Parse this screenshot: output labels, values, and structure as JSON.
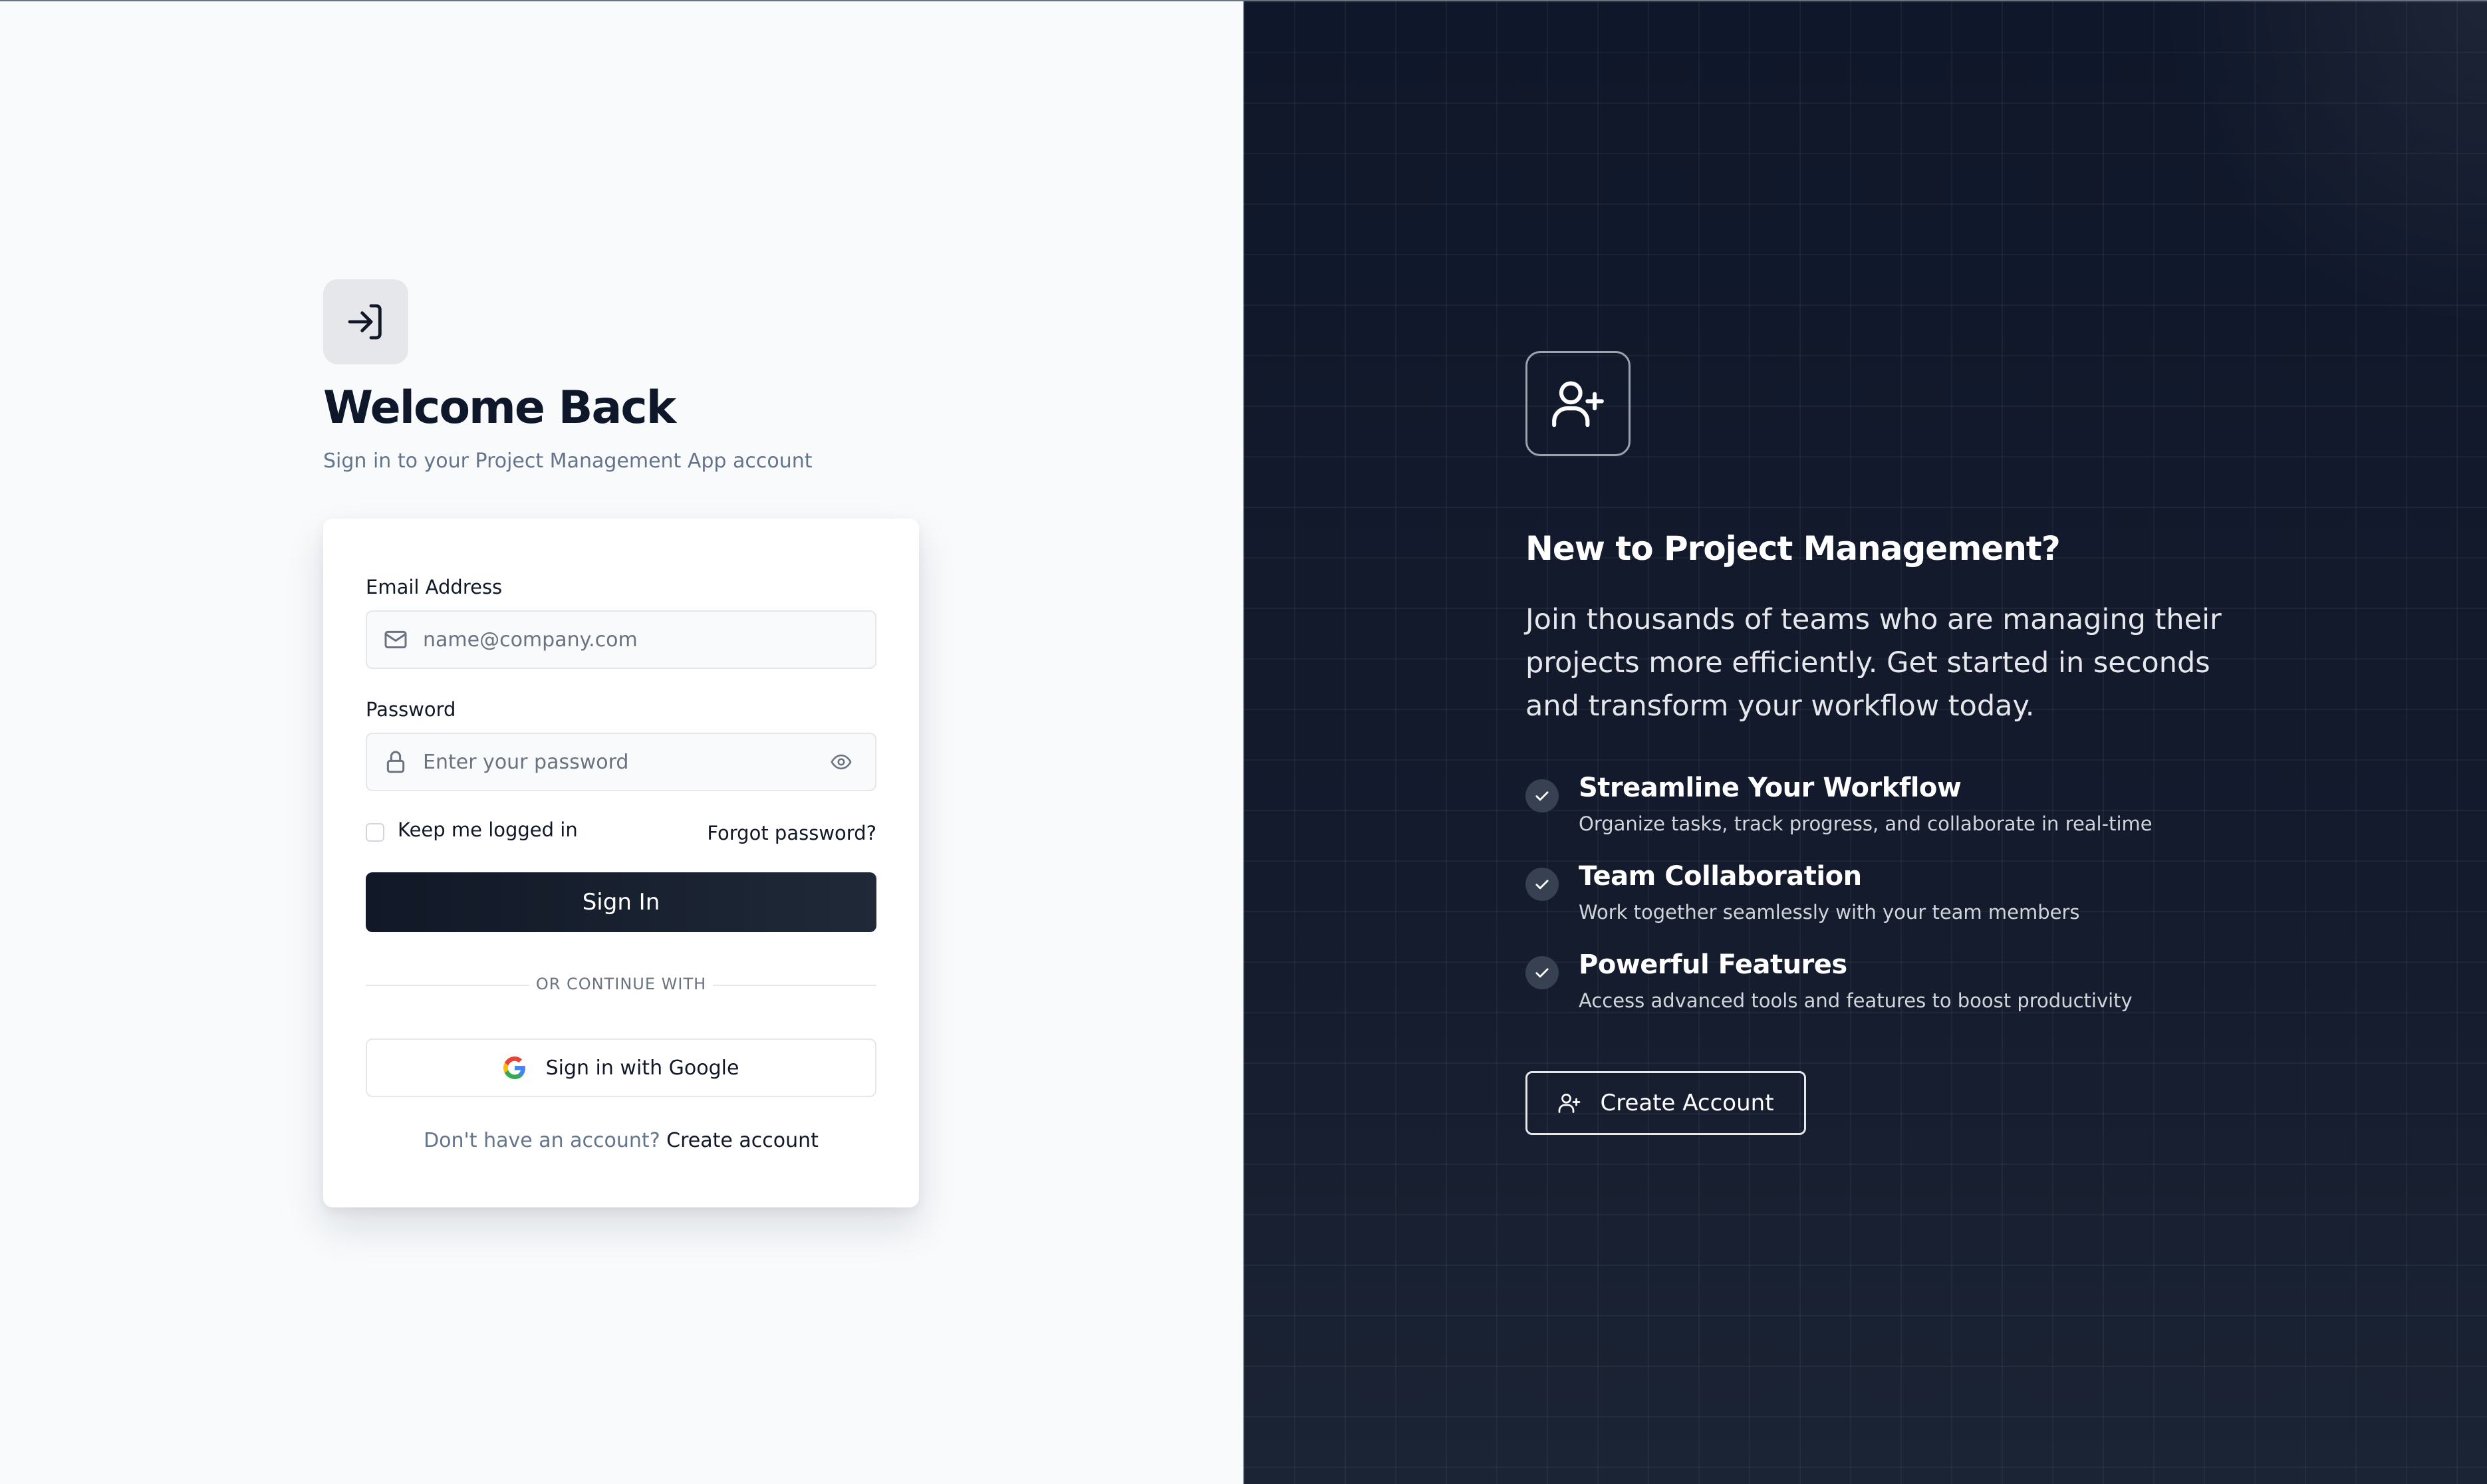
{
  "login": {
    "title": "Welcome Back",
    "subtitle": "Sign in to your Project Management App account",
    "email_label": "Email Address",
    "email_placeholder": "name@company.com",
    "email_value": "",
    "password_label": "Password",
    "password_placeholder": "Enter your password",
    "password_value": "",
    "remember_label": "Keep me logged in",
    "remember_checked": false,
    "forgot_link": "Forgot password?",
    "signin_button": "Sign In",
    "divider_text": "OR CONTINUE WITH",
    "google_button": "Sign in with Google",
    "signup_prompt": "Don't have an account?",
    "signup_link": "Create account"
  },
  "promo": {
    "title": "New to Project Management?",
    "description": "Join thousands of teams who are managing their projects more efficiently. Get started in seconds and transform your workflow today.",
    "features": [
      {
        "title": "Streamline Your Workflow",
        "description": "Organize tasks, track progress, and collaborate in real-time"
      },
      {
        "title": "Team Collaboration",
        "description": "Work together seamlessly with your team members"
      },
      {
        "title": "Powerful Features",
        "description": "Access advanced tools and features to boost productivity"
      }
    ],
    "create_button": "Create Account"
  },
  "icons": {
    "login_logo": "login-arrow-icon",
    "email": "mail-icon",
    "password": "lock-icon",
    "toggle_password": "eye-icon",
    "google": "google-icon",
    "promo": "user-plus-icon",
    "feature_check": "check-icon",
    "create_account": "user-plus-icon"
  },
  "colors": {
    "primary_dark": "#111827",
    "left_background": "#f8fafc",
    "right_background": "#111827",
    "muted_text": "#64748b"
  }
}
